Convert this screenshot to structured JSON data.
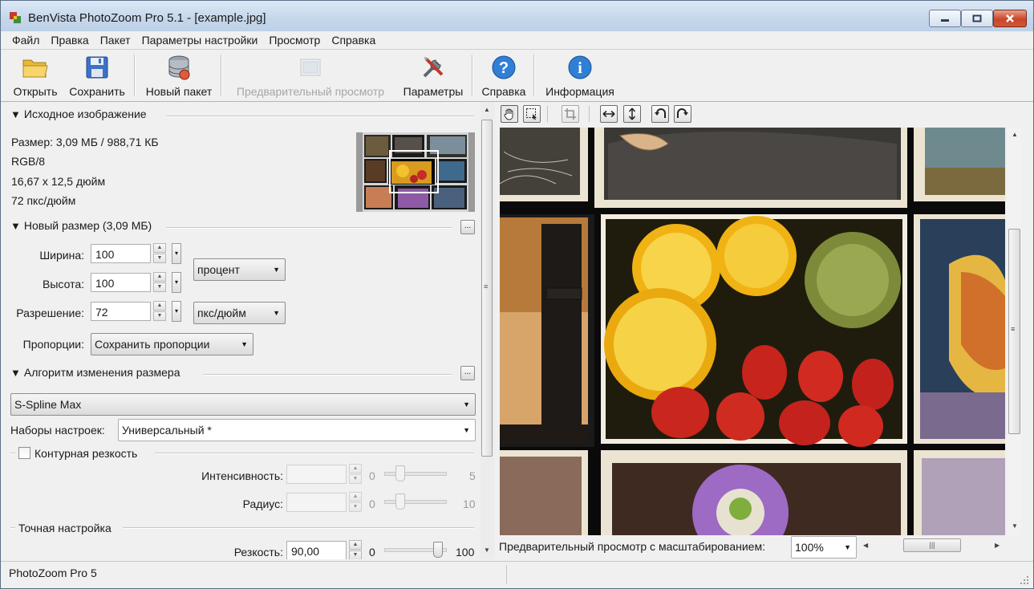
{
  "window": {
    "title": "BenVista PhotoZoom Pro 5.1 - [example.jpg]",
    "min_glyph": "–",
    "max_glyph": "□",
    "close_glyph": "✕"
  },
  "menu": [
    "Файл",
    "Правка",
    "Пакет",
    "Параметры настройки",
    "Просмотр",
    "Справка"
  ],
  "toolbar": {
    "open": "Открыть",
    "save": "Сохранить",
    "new_batch": "Новый пакет",
    "preview": "Предварительный просмотр",
    "settings": "Параметры",
    "help": "Справка",
    "info": "Информация"
  },
  "source": {
    "heading": "Исходное изображение",
    "size": "Размер: 3,09 МБ / 988,71 КБ",
    "mode": "RGB/8",
    "dimensions": "16,67 x 12,5 дюйм",
    "resolution": "72 пкс/дюйм"
  },
  "new_size": {
    "heading": "Новый размер (3,09 МБ)",
    "dots": "...",
    "width_label": "Ширина:",
    "width_value": "100",
    "height_label": "Высота:",
    "height_value": "100",
    "res_label": "Разрешение:",
    "res_value": "72",
    "unit_size": "процент",
    "unit_res": "пкс/дюйм",
    "proportions_label": "Пропорции:",
    "proportions_value": "Сохранить пропорции"
  },
  "algorithm": {
    "heading": "Алгоритм изменения размера",
    "dots": "...",
    "method": "S-Spline Max",
    "presets_label": "Наборы настроек:",
    "presets_value": "Универсальный *",
    "contour_label": "Контурная резкость",
    "intensity_label": "Интенсивность:",
    "intensity_min": "0",
    "intensity_max": "5",
    "radius_label": "Радиус:",
    "radius_min": "0",
    "radius_max": "10",
    "fine_heading": "Точная настройка",
    "sharpness_label": "Резкость:",
    "sharpness_value": "90,00",
    "sharpness_min": "0",
    "sharpness_max": "100"
  },
  "controls": {
    "intensity_level": 0.2,
    "radius_level": 0.2,
    "sharpness_level": 0.9
  },
  "preview": {
    "zoom_label": "Предварительный просмотр с масштабированием:",
    "zoom_value": "100%"
  },
  "status": {
    "text": "PhotoZoom Pro 5"
  }
}
